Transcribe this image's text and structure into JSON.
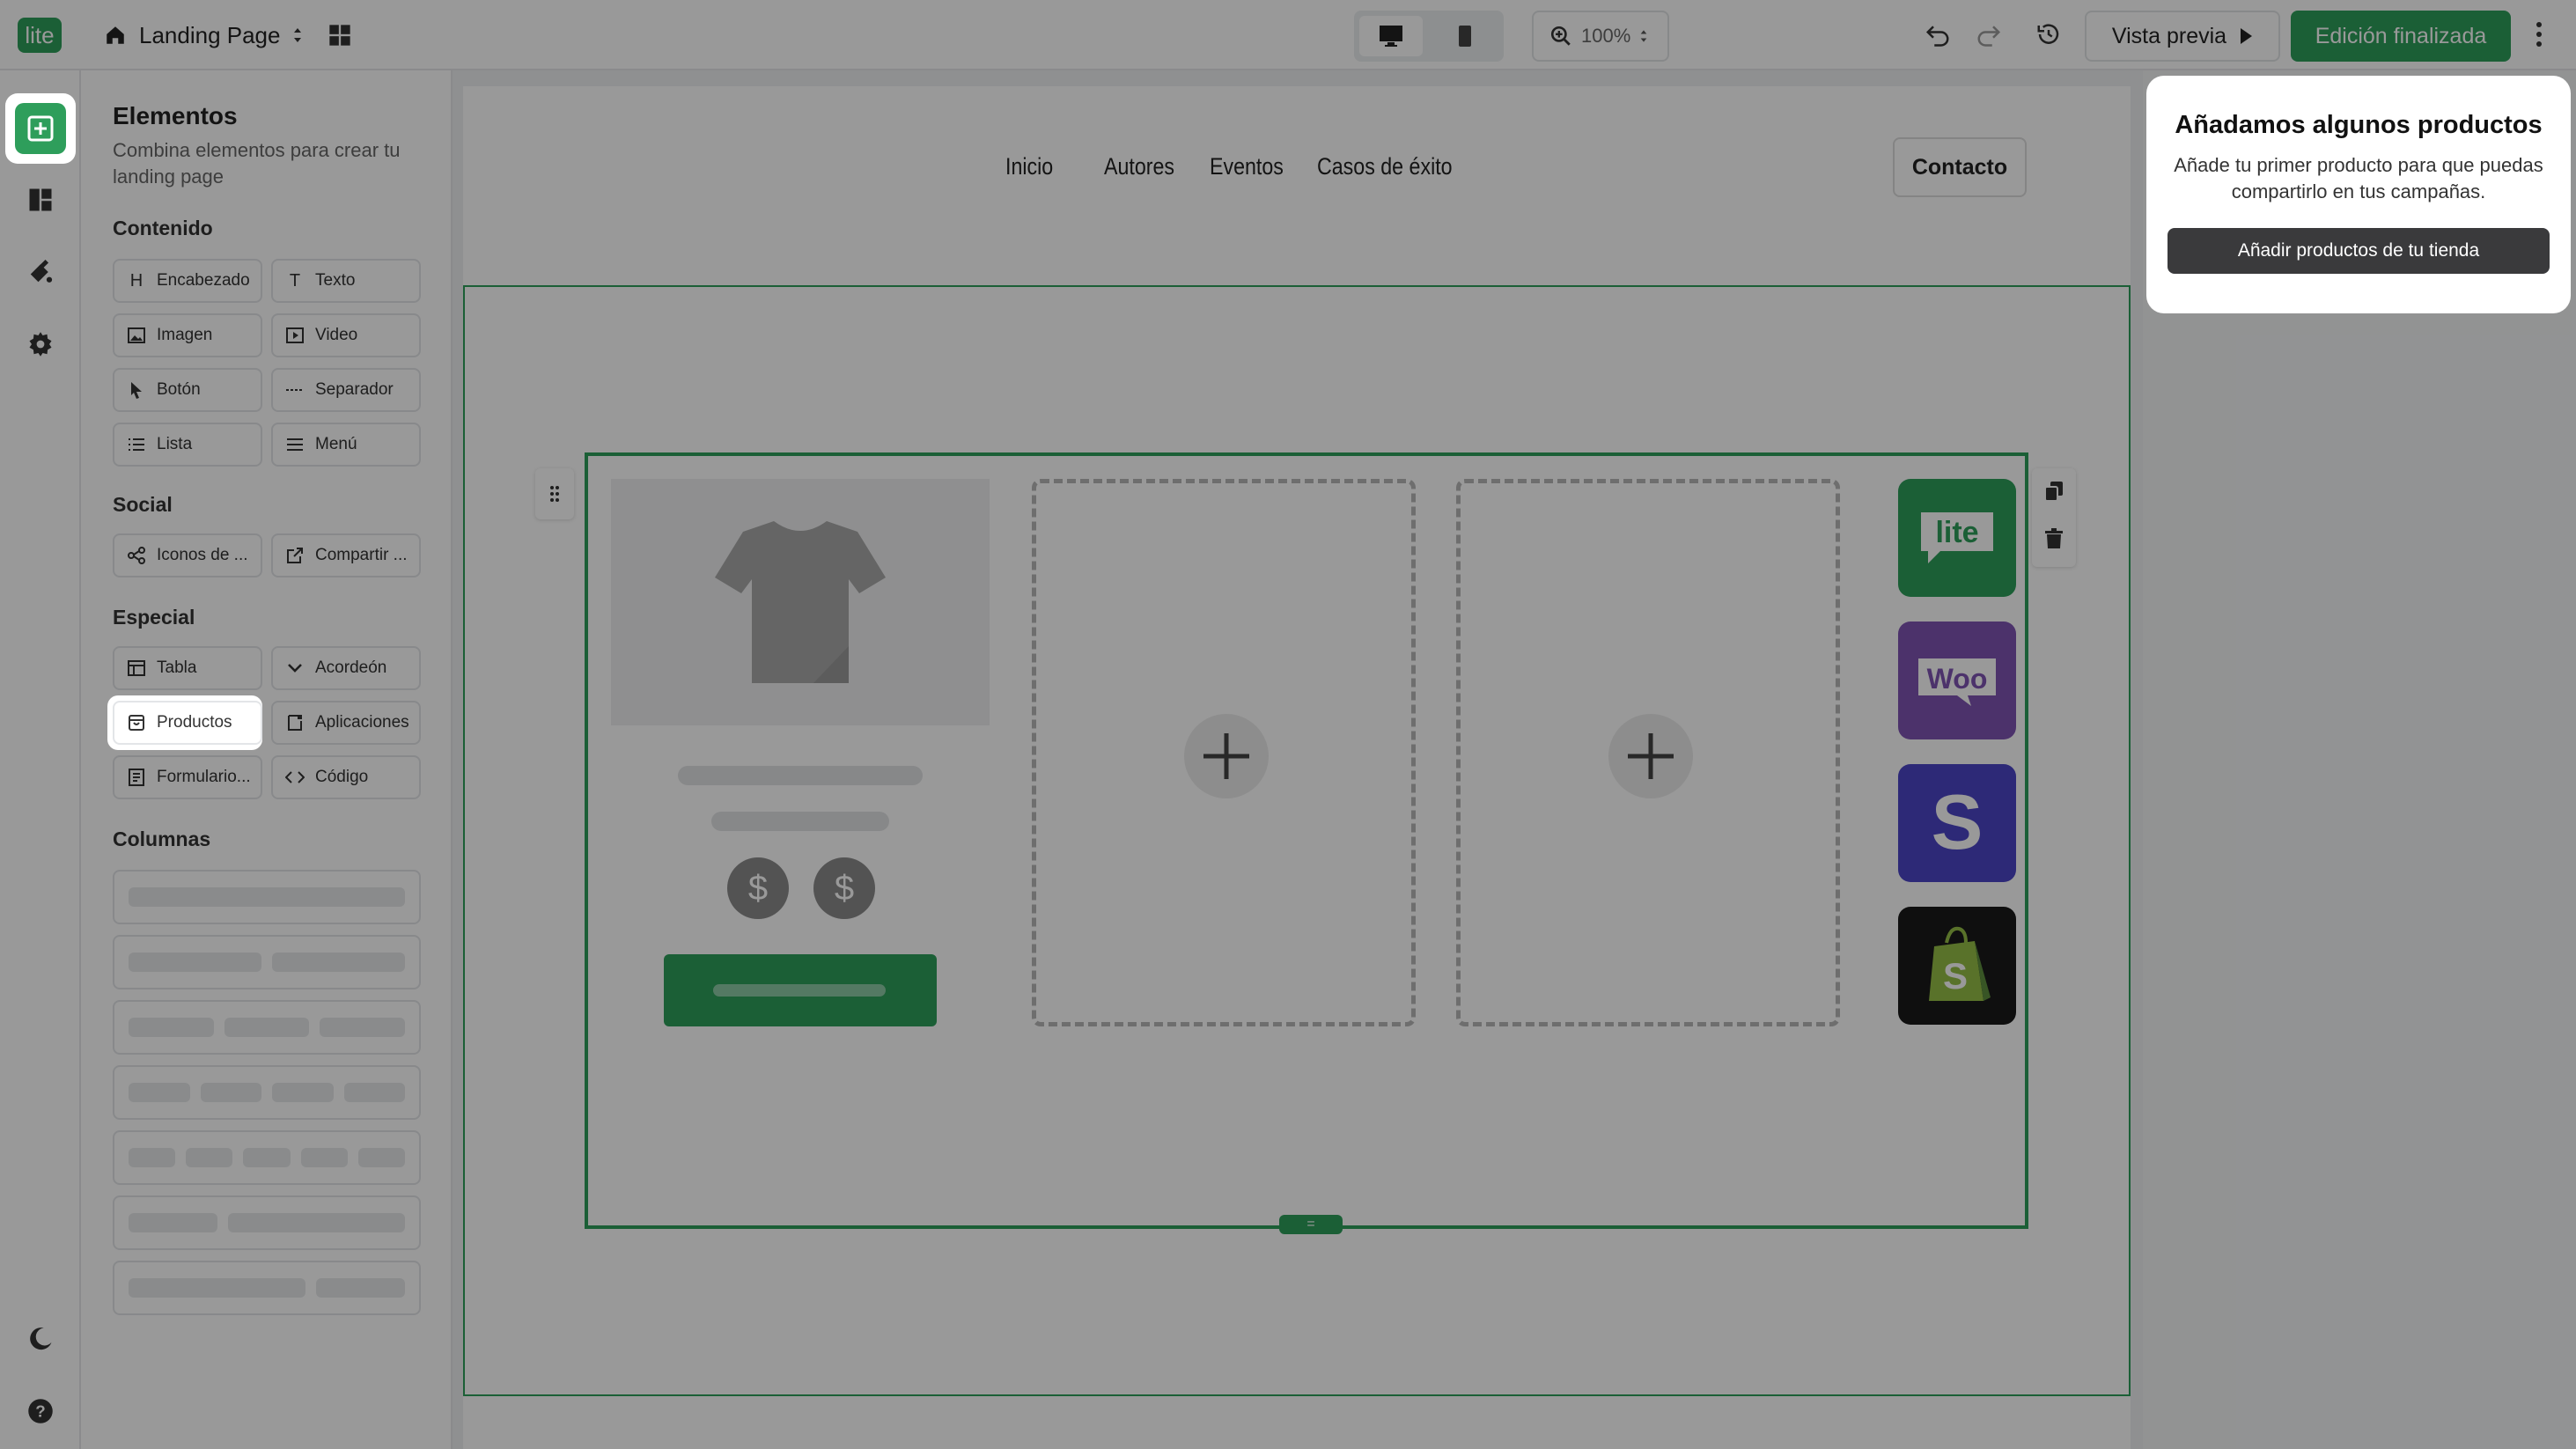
{
  "topbar": {
    "logo_text": "lite",
    "page_name": "Landing Page",
    "zoom_value": "100%",
    "preview_label": "Vista previa",
    "finish_label": "Edición finalizada"
  },
  "panel": {
    "title": "Elementos",
    "subtitle": "Combina elementos para crear tu landing page",
    "sections": {
      "contenido": "Contenido",
      "social": "Social",
      "especial": "Especial",
      "columnas": "Columnas"
    },
    "contenido_items": [
      {
        "label": "Encabezado",
        "icon": "heading-icon"
      },
      {
        "label": "Texto",
        "icon": "text-icon"
      },
      {
        "label": "Imagen",
        "icon": "image-icon"
      },
      {
        "label": "Video",
        "icon": "video-icon"
      },
      {
        "label": "Botón",
        "icon": "cursor-icon"
      },
      {
        "label": "Separador",
        "icon": "separator-icon"
      },
      {
        "label": "Lista",
        "icon": "list-icon"
      },
      {
        "label": "Menú",
        "icon": "menu-icon"
      }
    ],
    "social_items": [
      {
        "label": "Iconos de ...",
        "icon": "share-nodes-icon"
      },
      {
        "label": "Compartir ...",
        "icon": "external-share-icon"
      }
    ],
    "especial_items": [
      {
        "label": "Tabla",
        "icon": "table-icon"
      },
      {
        "label": "Acordeón",
        "icon": "chevron-down-icon"
      },
      {
        "label": "Productos",
        "icon": "store-icon"
      },
      {
        "label": "Aplicaciones",
        "icon": "app-icon"
      },
      {
        "label": "Formulario...",
        "icon": "form-icon"
      },
      {
        "label": "Código",
        "icon": "code-icon"
      }
    ]
  },
  "canvas": {
    "nav_links": [
      "Inicio",
      "Autores",
      "Eventos",
      "Casos de éxito"
    ],
    "contact_label": "Contacto",
    "price_symbol": "$",
    "integrations": [
      {
        "name": "lite",
        "color": "#2e9e5b"
      },
      {
        "name": "Woo",
        "color": "#7f54b3"
      },
      {
        "name": "S",
        "color": "#4b45c6"
      },
      {
        "name": "shopify",
        "color": "#1a1a1a"
      }
    ]
  },
  "tooltip": {
    "title": "Añadamos algunos productos",
    "body": "Añade tu primer producto para que puedas compartirlo en tus campañas.",
    "button_label": "Añadir productos de tu tienda"
  },
  "colors": {
    "brand_green": "#2e9e5b",
    "tooltip_button": "#3a3a3c"
  }
}
